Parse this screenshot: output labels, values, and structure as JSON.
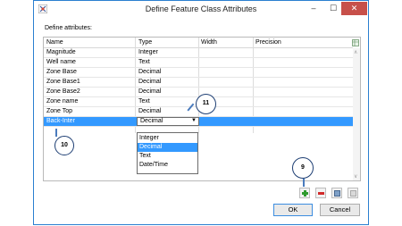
{
  "window": {
    "title": "Define Feature Class Attributes",
    "minimize": "–",
    "maximize": "☐",
    "close": "✕"
  },
  "define_label": "Define attributes:",
  "columns": [
    "Name",
    "Type",
    "Width",
    "Precision"
  ],
  "rows": [
    {
      "name": "Magnitude",
      "type": "Integer"
    },
    {
      "name": "Well name",
      "type": "Text"
    },
    {
      "name": "Zone Base",
      "type": "Decimal"
    },
    {
      "name": "Zone Base1",
      "type": "Decimal"
    },
    {
      "name": "Zone Base2",
      "type": "Decimal"
    },
    {
      "name": "Zone name",
      "type": "Text"
    },
    {
      "name": "Zone Top",
      "type": "Decimal"
    }
  ],
  "selected_row": {
    "name": "Back-Inter",
    "type": "Decimal"
  },
  "type_options": [
    "Integer",
    "Decimal",
    "Text",
    "Date/Time"
  ],
  "highlighted_option": "Decimal",
  "callouts": [
    "11",
    "10",
    "9"
  ],
  "buttons": {
    "ok": "OK",
    "cancel": "Cancel"
  },
  "icons": [
    "app-icon",
    "column-chooser-icon",
    "add-icon",
    "delete-icon",
    "edit-icon",
    "lock-icon",
    "dropdown-arrow-icon"
  ],
  "colors": {
    "selection": "#3399ff",
    "close_button": "#c7504a",
    "callout_border": "#1d3e73",
    "add": "#2e9a2e",
    "delete": "#d12a2a"
  }
}
